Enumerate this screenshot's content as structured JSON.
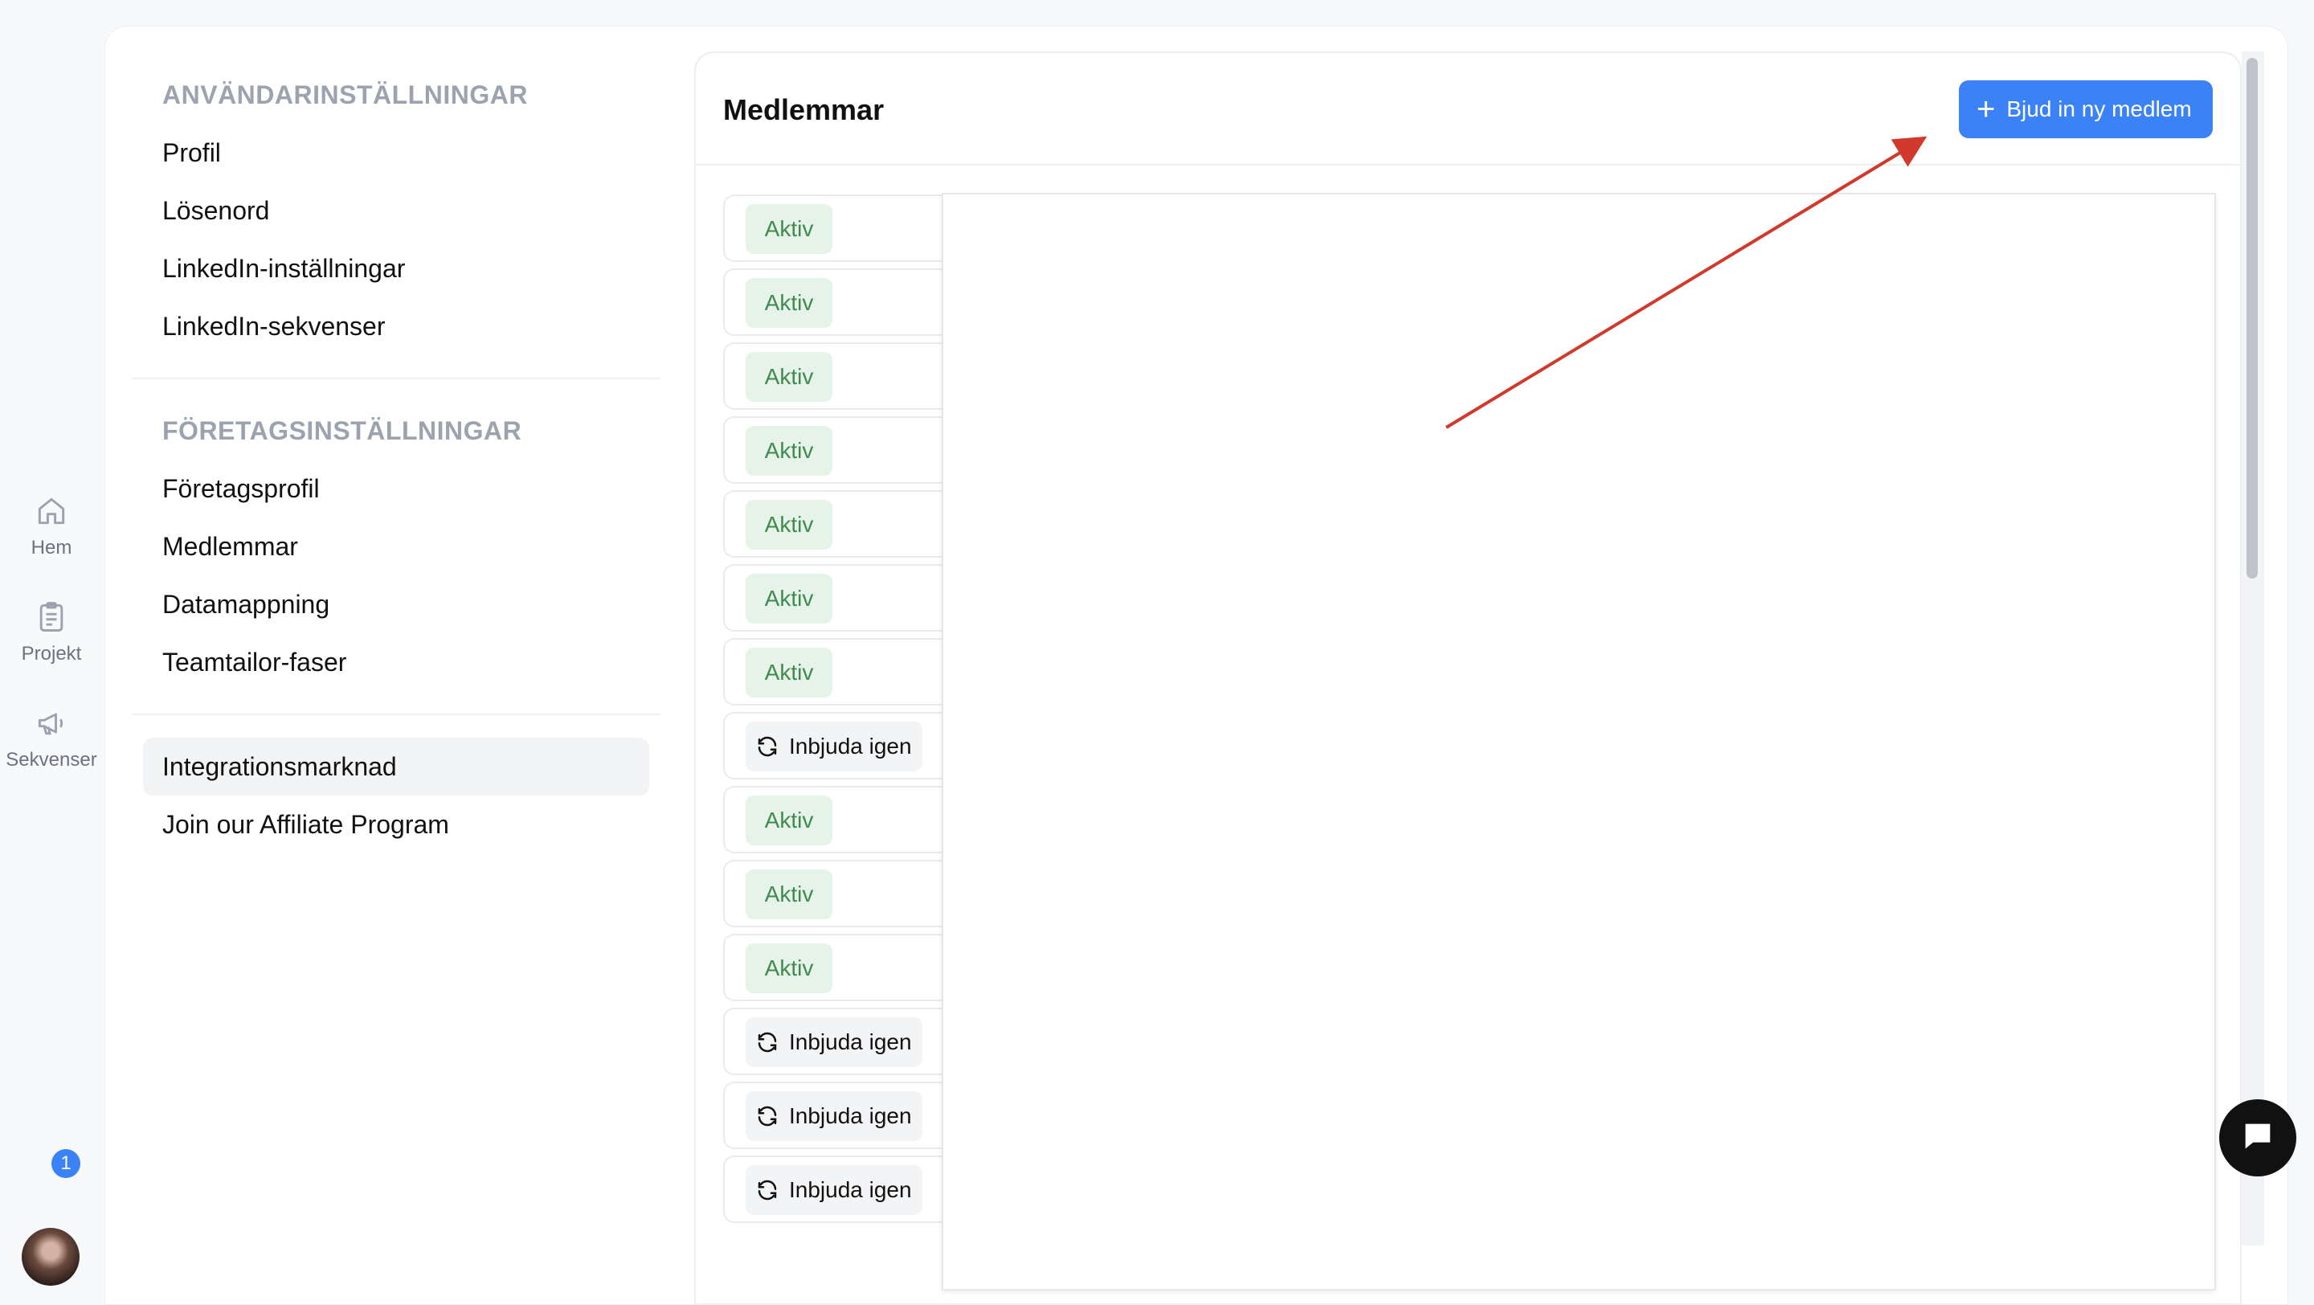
{
  "rail": {
    "items": [
      {
        "label": "Hem",
        "icon": "home-icon"
      },
      {
        "label": "Projekt",
        "icon": "clipboard-icon"
      },
      {
        "label": "Sekvenser",
        "icon": "megaphone-icon"
      }
    ],
    "notification_count": "1"
  },
  "settings": {
    "user_section_title": "ANVÄNDARINSTÄLLNINGAR",
    "user_items": [
      "Profil",
      "Lösenord",
      "LinkedIn-inställningar",
      "LinkedIn-sekvenser"
    ],
    "company_section_title": "FÖRETAGSINSTÄLLNINGAR",
    "company_items": [
      "Företagsprofil",
      "Medlemmar",
      "Datamappning",
      "Teamtailor-faser"
    ],
    "other_items": [
      "Integrationsmarknad",
      "Join our Affiliate Program"
    ]
  },
  "members": {
    "title": "Medlemmar",
    "invite_button": "Bjud in ny medlem",
    "rows": [
      {
        "status": "Aktiv"
      },
      {
        "status": "Aktiv"
      },
      {
        "status": "Aktiv"
      },
      {
        "status": "Aktiv"
      },
      {
        "status": "Aktiv"
      },
      {
        "status": "Aktiv"
      },
      {
        "status": "Aktiv"
      },
      {
        "status": "Inbjuda igen"
      },
      {
        "status": "Aktiv"
      },
      {
        "status": "Aktiv"
      },
      {
        "status": "Aktiv"
      },
      {
        "status": "Inbjuda igen"
      },
      {
        "status": "Inbjuda igen"
      },
      {
        "status": "Inbjuda igen"
      }
    ]
  },
  "colors": {
    "accent": "#3b82f6",
    "active_pill_bg": "#e5f3e8",
    "active_pill_text": "#3f8a4e",
    "annotation_arrow": "#d0392b"
  }
}
